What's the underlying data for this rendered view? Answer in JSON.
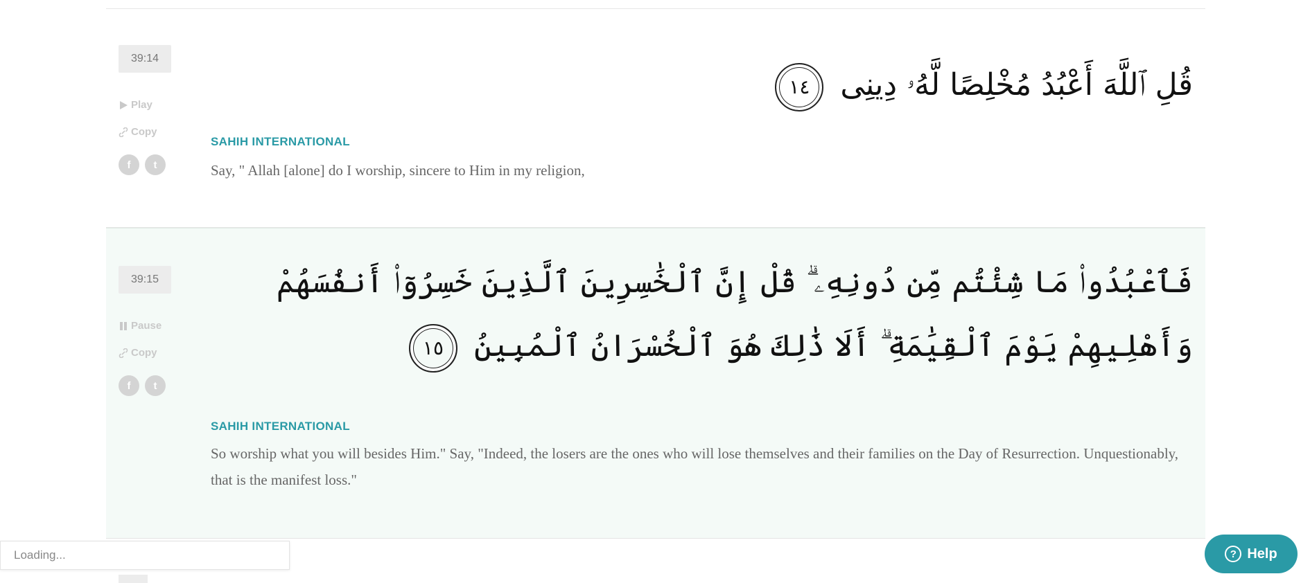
{
  "verses": [
    {
      "key": "39:14",
      "control_label": "Play",
      "copy_label": "Copy",
      "arabic": "قُلِ ٱللَّهَ أَعْبُدُ مُخْلِصًا لَّهُۥ دِينِى",
      "ayah_number": "١٤",
      "translation_label": "SAHIH INTERNATIONAL",
      "translation": "Say, \" Allah [alone] do I worship, sincere to Him in my religion,"
    },
    {
      "key": "39:15",
      "control_label": "Pause",
      "copy_label": "Copy",
      "arabic": "فَٱعْبُدُوا۟ مَا شِئْتُم مِّن دُونِهِۦ ۗ قُلْ إِنَّ ٱلْخَٰسِرِينَ ٱلَّذِينَ خَسِرُوٓا۟ أَنفُسَهُمْ وَأَهْلِيهِمْ يَوْمَ ٱلْقِيَٰمَةِ ۗ أَلَا ذَٰلِكَ هُوَ ٱلْخُسْرَانُ ٱلْمُبِينُ",
      "ayah_number": "١٥",
      "translation_label": "SAHIH INTERNATIONAL",
      "translation": "So worship what you will besides Him.\" Say, \"Indeed, the losers are the ones who will lose themselves and their families on the Day of Resurrection. Unquestionably, that is the manifest loss.\""
    }
  ],
  "social": {
    "facebook_glyph": "f",
    "twitter_glyph": "t"
  },
  "loading_text": "Loading...",
  "help_label": "Help",
  "icons": {
    "play": "play-icon",
    "pause": "pause-icon",
    "copy": "link-icon",
    "help": "question-icon"
  },
  "colors": {
    "accent": "#2a9aa6",
    "active_bg": "#f4faf7",
    "badge_bg": "#ececec"
  }
}
